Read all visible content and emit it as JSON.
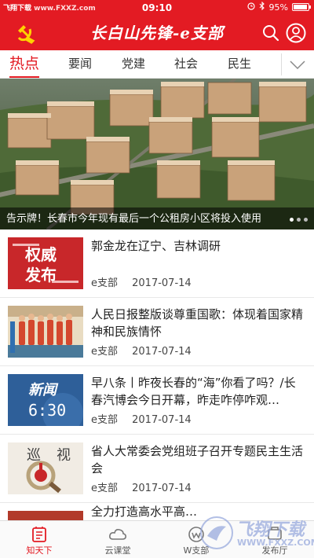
{
  "status_bar": {
    "watermark_brand": "飞翔下载",
    "watermark_site": "www.FXXZ.com",
    "time": "09:10",
    "battery": "95%",
    "battery_level": 0.95
  },
  "header": {
    "title": "长白山先锋-e支部"
  },
  "tabs": [
    {
      "label": "热点",
      "active": true
    },
    {
      "label": "要闻"
    },
    {
      "label": "党建"
    },
    {
      "label": "社会"
    },
    {
      "label": "民生"
    }
  ],
  "banner": {
    "caption": "告示牌！长春市今年现有最后一个公租房小区将投入使用",
    "dots": 3
  },
  "news": [
    {
      "headline": "郭金龙在辽宁、吉林调研",
      "source": "e支部",
      "date": "2017-07-14",
      "thumb_text": [
        "权威",
        "发布"
      ]
    },
    {
      "headline": "人民日报整版谈尊重国歌：体现着国家精神和民族情怀",
      "source": "e支部",
      "date": "2017-07-14"
    },
    {
      "headline": "早八条丨昨夜长春的“海”你看了吗？/长春汽博会今日开幕，昨走咋停咋观…",
      "source": "e支部",
      "date": "2017-07-14",
      "thumb_text": [
        "新闻",
        "6:30"
      ]
    },
    {
      "headline": "省人大常委会党组班子召开专题民主生活会",
      "source": "e支部",
      "date": "2017-07-14",
      "thumb_text": [
        "巡",
        "视"
      ]
    },
    {
      "headline": "全力打造高水平高…"
    }
  ],
  "bottom_nav": [
    {
      "label": "知天下",
      "icon": "news-icon",
      "active": true
    },
    {
      "label": "云课堂",
      "icon": "cloud-icon"
    },
    {
      "label": "W支部",
      "icon": "branch-icon"
    },
    {
      "label": "发布厅",
      "icon": "publish-icon"
    }
  ],
  "watermark": {
    "brand": "飞翔下载",
    "site": "WWW.FXXZ.COM"
  },
  "colors": {
    "brand_red": "#e31b23"
  }
}
